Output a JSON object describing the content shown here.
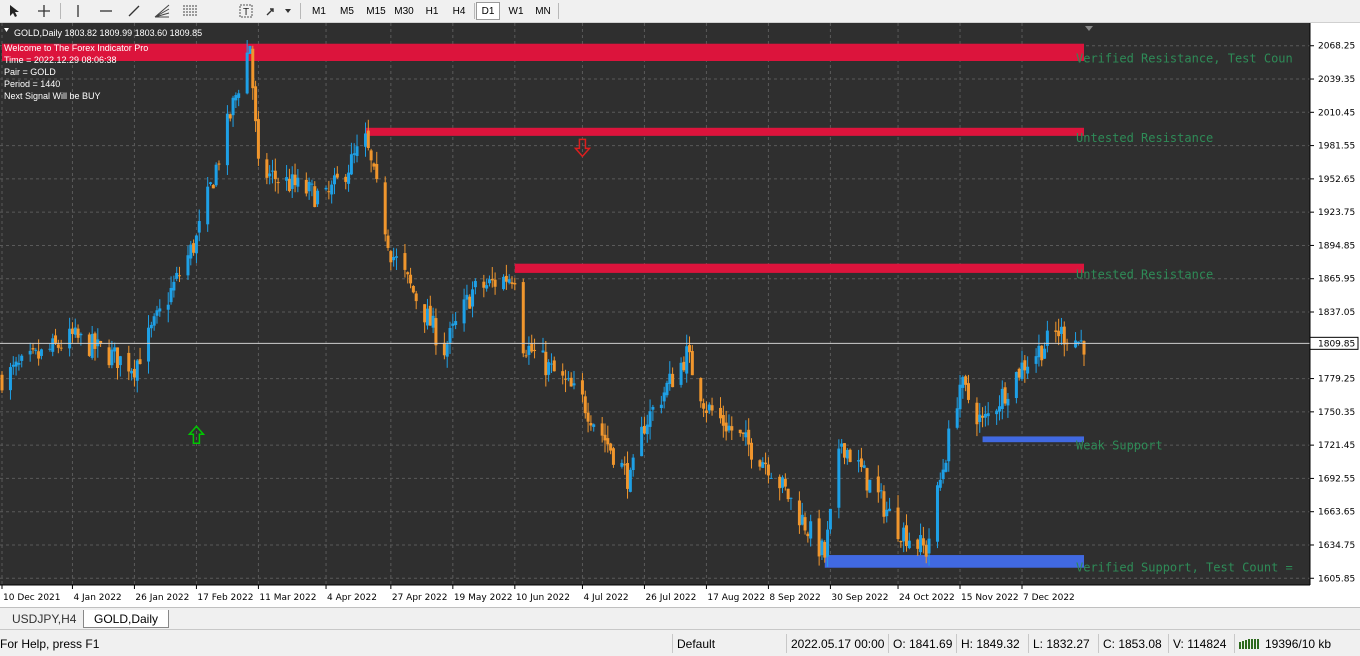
{
  "toolbar": {
    "icons": [
      "cursor-icon",
      "crosshair-icon",
      "vertical-line-icon",
      "horizontal-line-icon",
      "trendline-icon",
      "fibonacci-fan-icon",
      "fibonacci-icon",
      "text-label-icon",
      "arrows-icon"
    ],
    "timeframes": [
      "M1",
      "M5",
      "M15",
      "M30",
      "H1",
      "H4",
      "D1",
      "W1",
      "MN"
    ],
    "active_timeframe": "D1"
  },
  "chart": {
    "header": "GOLD,Daily  1803.82 1809.99 1803.60 1809.85",
    "current_price": "1809.85",
    "info_lines": [
      "Welcome to The Forex Indicator Pro",
      "Time = 2022.12.29 08:06:38",
      "Pair = GOLD",
      "Period = 1440",
      "Next Signal Will be BUY"
    ],
    "zone_labels": [
      "Verified Resistance, Test Coun",
      "Untested Resistance",
      "Untested Resistance",
      "Weak Support",
      "Verified Support, Test Count ="
    ],
    "price_ticks": [
      "2068.25",
      "2039.35",
      "2010.45",
      "1981.55",
      "1952.65",
      "1923.75",
      "1894.85",
      "1865.95",
      "1837.05",
      "1779.25",
      "1750.35",
      "1721.45",
      "1692.55",
      "1663.65",
      "1634.75",
      "1605.85"
    ],
    "date_ticks": [
      "10 Dec 2021",
      "4 Jan 2022",
      "26 Jan 2022",
      "17 Feb 2022",
      "11 Mar 2022",
      "4 Apr 2022",
      "27 Apr 2022",
      "19 May 2022",
      "10 Jun 2022",
      "4 Jul 2022",
      "26 Jul 2022",
      "17 Aug 2022",
      "8 Sep 2022",
      "30 Sep 2022",
      "24 Oct 2022",
      "15 Nov 2022",
      "7 Dec 2022"
    ],
    "colors": {
      "background": "#2f2f2f",
      "grid": "#5a5a5a",
      "bull_candle": "#1ea0e6",
      "bear_candle": "#f0962d",
      "resistance_zone": "#dc143c",
      "support_zone": "#4169e1",
      "zone_label": "#2e8b57",
      "buy_arrow": "#00c800",
      "sell_arrow": "#dc1e1e"
    }
  },
  "tabs": [
    "USDJPY,H4",
    "GOLD,Daily"
  ],
  "active_tab": "GOLD,Daily",
  "status": {
    "help": "For Help, press F1",
    "profile": "Default",
    "datetime": "2022.05.17 00:00",
    "open": "O: 1841.69",
    "high": "H: 1849.32",
    "low": "L: 1832.27",
    "close": "C: 1853.08",
    "volume": "V: 114824",
    "traffic": "19396/10 kb"
  },
  "chart_data": {
    "type": "candlestick",
    "symbol": "GOLD",
    "timeframe": "Daily",
    "ylim": [
      1600,
      2088
    ],
    "last_price": 1809.85,
    "key_points": [
      {
        "date": "10 Dec 2021",
        "price": 1780
      },
      {
        "date": "4 Jan 2022",
        "price": 1815
      },
      {
        "date": "26 Jan 2022",
        "price": 1790
      },
      {
        "date": "17 Feb 2022",
        "price": 1900
      },
      {
        "date": "8 Mar 2022",
        "price": 2070
      },
      {
        "date": "11 Mar 2022",
        "price": 1960
      },
      {
        "date": "4 Apr 2022",
        "price": 1935
      },
      {
        "date": "18 Apr 2022",
        "price": 1985
      },
      {
        "date": "27 Apr 2022",
        "price": 1890
      },
      {
        "date": "16 May 2022",
        "price": 1805
      },
      {
        "date": "26 May 2022",
        "price": 1855
      },
      {
        "date": "10 Jun 2022",
        "price": 1870
      },
      {
        "date": "13 Jun 2022",
        "price": 1810
      },
      {
        "date": "4 Jul 2022",
        "price": 1760
      },
      {
        "date": "21 Jul 2022",
        "price": 1690
      },
      {
        "date": "26 Jul 2022",
        "price": 1740
      },
      {
        "date": "10 Aug 2022",
        "price": 1800
      },
      {
        "date": "17 Aug 2022",
        "price": 1755
      },
      {
        "date": "8 Sep 2022",
        "price": 1705
      },
      {
        "date": "28 Sep 2022",
        "price": 1625
      },
      {
        "date": "4 Oct 2022",
        "price": 1725
      },
      {
        "date": "24 Oct 2022",
        "price": 1650
      },
      {
        "date": "3 Nov 2022",
        "price": 1630
      },
      {
        "date": "15 Nov 2022",
        "price": 1775
      },
      {
        "date": "23 Nov 2022",
        "price": 1740
      },
      {
        "date": "7 Dec 2022",
        "price": 1790
      },
      {
        "date": "20 Dec 2022",
        "price": 1820
      },
      {
        "date": "29 Dec 2022",
        "price": 1809.85
      }
    ],
    "zones": [
      {
        "type": "resistance",
        "label": "Verified Resistance, Test Coun",
        "low": 2055,
        "high": 2070,
        "start": "10 Dec 2021"
      },
      {
        "type": "resistance",
        "label": "Untested Resistance",
        "low": 1990,
        "high": 1997,
        "start": "18 Apr 2022"
      },
      {
        "type": "resistance",
        "label": "Untested Resistance",
        "low": 1871,
        "high": 1879,
        "start": "10 Jun 2022"
      },
      {
        "type": "support",
        "label": "Weak Support",
        "low": 1724,
        "high": 1729,
        "start": "23 Nov 2022"
      },
      {
        "type": "support",
        "label": "Verified Support, Test Count =",
        "low": 1615,
        "high": 1626,
        "start": "28 Sep 2022"
      }
    ],
    "signals": [
      {
        "type": "buy",
        "date": "17 Feb 2022",
        "price": 1730
      },
      {
        "type": "sell",
        "date": "4 Jul 2022",
        "price": 1980
      }
    ]
  }
}
